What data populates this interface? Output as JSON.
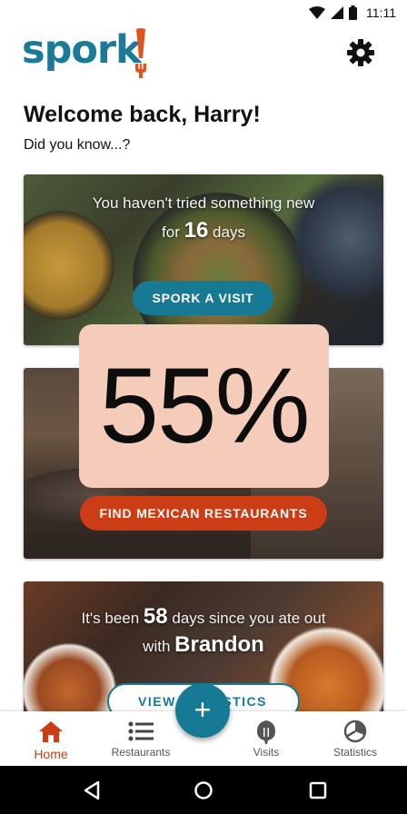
{
  "status_bar": {
    "time": "11:11"
  },
  "header": {
    "logo": "spork",
    "logo_bang": "!"
  },
  "welcome": {
    "title": "Welcome back, Harry!",
    "subtitle": "Did you know...?"
  },
  "cards": {
    "card1": {
      "line1": "You haven't tried something new",
      "line2_prefix": "for",
      "days": "16",
      "line2_suffix": "days",
      "button": "SPORK A VISIT"
    },
    "card2": {
      "button": "FIND MEXICAN RESTAURANTS"
    },
    "card3": {
      "line1_prefix": "It's been",
      "days": "58",
      "line1_suffix": "days since you ate out",
      "line2_prefix": "with",
      "name": "Brandon",
      "button_left": "VIEW",
      "button_right": "STICS"
    }
  },
  "overlay": {
    "percent": "55%"
  },
  "fab": {
    "label": "+"
  },
  "bottom_nav": {
    "items": [
      {
        "label": "Home",
        "icon": "home-icon",
        "active": true
      },
      {
        "label": "Restaurants",
        "icon": "list-icon",
        "active": false
      },
      {
        "label": "Visits",
        "icon": "spoon-icon",
        "active": false
      },
      {
        "label": "Statistics",
        "icon": "pie-chart-icon",
        "active": false
      }
    ]
  },
  "colors": {
    "brand_teal": "#177a95",
    "brand_red": "#cc3c15",
    "overlay_bg": "#f5cbb9"
  }
}
